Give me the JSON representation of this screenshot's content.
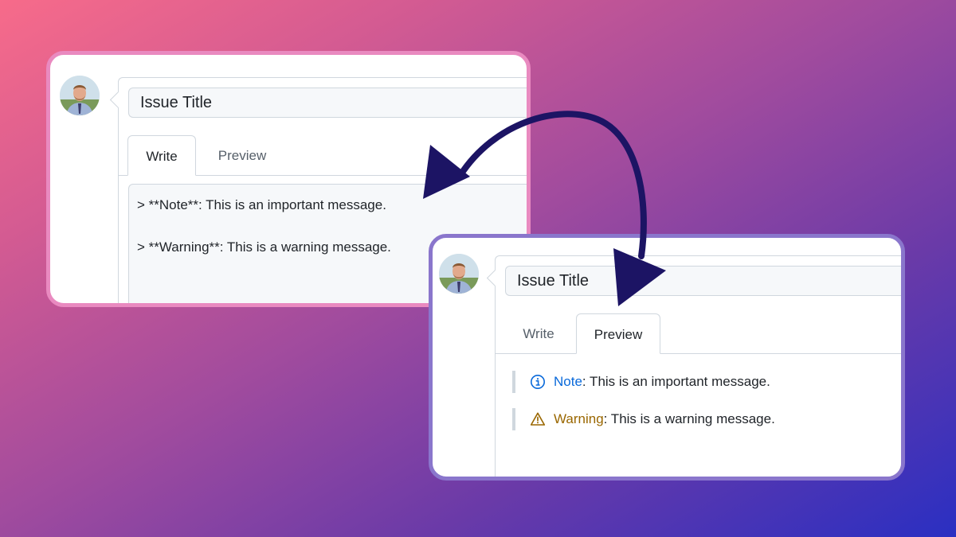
{
  "write_card": {
    "title_value": "Issue Title",
    "tabs": [
      {
        "label": "Write",
        "active": true
      },
      {
        "label": "Preview",
        "active": false
      }
    ],
    "editor_lines": [
      "> **Note**: This is an important message.",
      "> **Warning**: This is a warning message."
    ]
  },
  "preview_card": {
    "title_value": "Issue Title",
    "tabs": [
      {
        "label": "Write",
        "active": false
      },
      {
        "label": "Preview",
        "active": true
      }
    ],
    "alerts": [
      {
        "keyword": "Note",
        "text": ": This is an important message.",
        "icon": "info-icon",
        "color": "#0969da"
      },
      {
        "keyword": "Warning",
        "text": ": This is a warning message.",
        "icon": "warning-icon",
        "color": "#9a6700"
      }
    ]
  },
  "colors": {
    "write_card_border": "#e98ac0",
    "preview_card_border": "#8a76cc",
    "arrow": "#1c1464"
  }
}
